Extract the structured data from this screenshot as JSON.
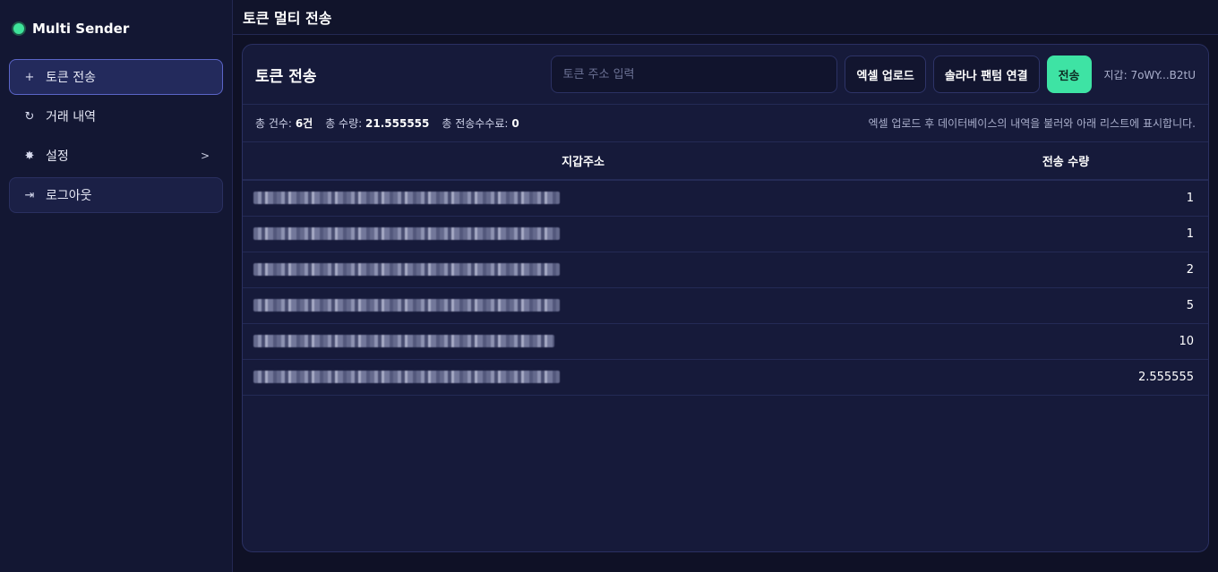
{
  "app": {
    "name": "Multi Sender",
    "accent": "#3ee39a"
  },
  "sidebar": {
    "items": [
      {
        "label": "토큰 전송",
        "icon": "plus-icon",
        "glyph": "+",
        "active": true
      },
      {
        "label": "거래 내역",
        "icon": "history-icon",
        "glyph": "↻"
      },
      {
        "label": "설정",
        "icon": "gear-icon",
        "glyph": "✸",
        "chevron": ">"
      },
      {
        "label": "로그아웃",
        "icon": "logout-icon",
        "glyph": "⇥"
      }
    ]
  },
  "topbar": {
    "title": "토큰 멀티 전송"
  },
  "card": {
    "title": "토큰 전송",
    "input_placeholder": "토큰 주소 입력",
    "btn_excel": "엑셀 업로드",
    "btn_phantom": "솔라나 팬텀 연결",
    "btn_send": "전송",
    "wallet": "지갑: 7oWY...B2tU"
  },
  "summary": {
    "count_label": "총 건수:",
    "count_value": "6건",
    "amount_label": "총 수량:",
    "amount_value": "21.555555",
    "fee_label": "총 전송수수료:",
    "fee_value": "0",
    "note": "엑셀 업로드 후 데이터베이스의 내역을 불러와 아래 리스트에 표시합니다."
  },
  "table": {
    "headers": [
      "지갑주소",
      "전송 수량"
    ],
    "rows": [
      {
        "amount": "1"
      },
      {
        "amount": "1"
      },
      {
        "amount": "2"
      },
      {
        "amount": "5"
      },
      {
        "amount": "10"
      },
      {
        "amount": "2.555555"
      }
    ]
  }
}
